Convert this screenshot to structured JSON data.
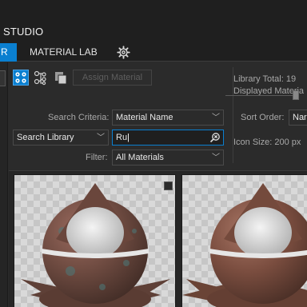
{
  "app": {
    "title": "STUDIO"
  },
  "tabs": {
    "active_label": "R",
    "material_lab_label": "MATERIAL LAB"
  },
  "toolbar": {
    "assign_label": "Assign Material"
  },
  "info": {
    "total": "Library Total: 19",
    "displayed": "Displayed Materia"
  },
  "search": {
    "criteria_label": "Search Criteria:",
    "criteria_value": "Material Name",
    "scope_value": "Search Library",
    "query_value": "Ru",
    "filter_label": "Filter:",
    "filter_value": "All Materials"
  },
  "sort": {
    "label": "Sort Order:",
    "value": "Nar"
  },
  "icon_size": {
    "label": "Icon Size: 200 px",
    "level": 0.95
  },
  "colors": {
    "accent": "#0a7fd0",
    "background": "#2b2b2b"
  },
  "icons": [
    "gear-icon",
    "grid-view-icon",
    "tree-view-icon",
    "copy-icon",
    "clear-search-icon",
    "chevron-down-icon"
  ]
}
